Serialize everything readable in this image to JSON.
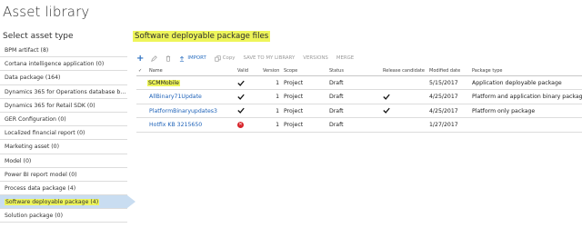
{
  "page_title": "Asset library",
  "sidebar": {
    "title": "Select asset type",
    "items": [
      {
        "label": "BPM artifact (8)"
      },
      {
        "label": "Cortana intelligence application (0)"
      },
      {
        "label": "Data package (164)"
      },
      {
        "label": "Dynamics 365 for Operations database ba..."
      },
      {
        "label": "Dynamics 365 for Retail SDK (0)"
      },
      {
        "label": "GER Configuration (0)"
      },
      {
        "label": "Localized financial report (0)"
      },
      {
        "label": "Marketing asset (0)"
      },
      {
        "label": "Model (0)"
      },
      {
        "label": "Power BI report model (0)"
      },
      {
        "label": "Process data package (4)"
      },
      {
        "label": "Software deployable package (4)",
        "selected": true
      },
      {
        "label": "Solution package (0)"
      }
    ]
  },
  "main": {
    "title": "Software deployable package files",
    "toolbar": {
      "add": "+",
      "import": "IMPORT",
      "copy": "Copy",
      "save_to_library": "SAVE TO MY LIBRARY",
      "versions": "VERSIONS",
      "merge": "MERGE"
    },
    "columns": {
      "select": "✓",
      "name": "Name",
      "valid": "Valid",
      "version": "Version",
      "scope": "Scope",
      "status": "Status",
      "release_candidate": "Release candidate",
      "modified_date": "Modified date",
      "package_type": "Package type"
    },
    "rows": [
      {
        "name": "SCMMobile",
        "valid": "check",
        "version": "1",
        "scope": "Project",
        "status": "Draft",
        "release_candidate": false,
        "modified": "5/15/2017",
        "package_type": "Application deployable package"
      },
      {
        "name": "AllBinary71Update",
        "valid": "check",
        "version": "1",
        "scope": "Project",
        "status": "Draft",
        "release_candidate": true,
        "modified": "4/25/2017",
        "package_type": "Platform and application binary package"
      },
      {
        "name": "PlatformBinaryupdates3",
        "valid": "check",
        "version": "1",
        "scope": "Project",
        "status": "Draft",
        "release_candidate": true,
        "modified": "4/25/2017",
        "package_type": "Platform only package"
      },
      {
        "name": "Hotfix KB 3215650",
        "valid": "error",
        "version": "1",
        "scope": "Project",
        "status": "Draft",
        "release_candidate": false,
        "modified": "1/27/2017",
        "package_type": ""
      }
    ]
  },
  "colors": {
    "highlight": "#eef55a",
    "selected_bg": "#c9ddf1",
    "link": "#1e62b8",
    "error": "#d8262c"
  },
  "icons": {
    "add": "plus-icon",
    "edit": "pencil-icon",
    "delete": "trash-icon",
    "copy": "copy-icon",
    "valid": "check-icon",
    "invalid": "error-icon"
  }
}
